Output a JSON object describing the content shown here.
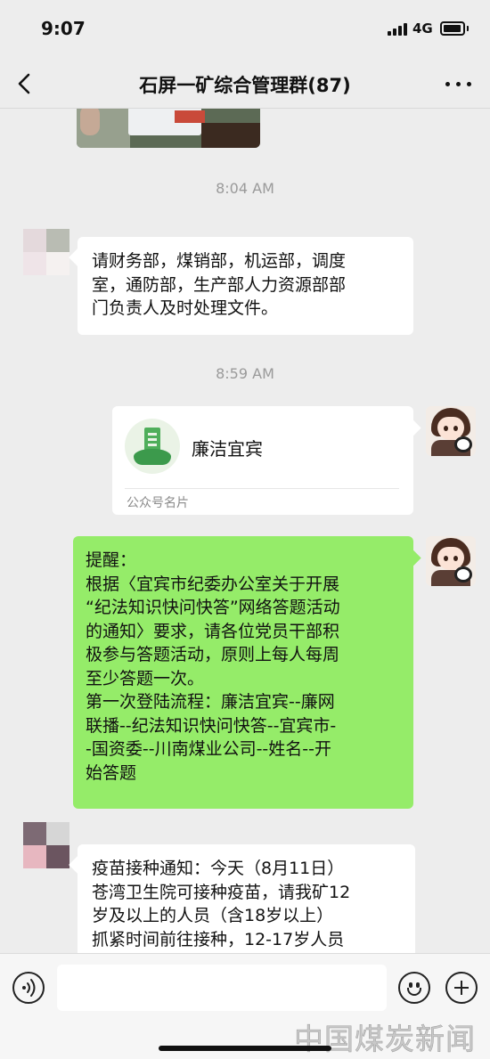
{
  "status_bar": {
    "time": "9:07",
    "network": "4G"
  },
  "nav": {
    "title": "石屏一矿综合管理群(87)"
  },
  "timestamps": [
    "8:04 AM",
    "8:59 AM"
  ],
  "messages": [
    {
      "side": "left",
      "type": "text",
      "lines": [
        "请财务部，煤销部，机运部，调度",
        "室，通防部，生产部人力资源部部",
        "门负责人及时处理文件。"
      ]
    },
    {
      "side": "right",
      "type": "card",
      "card_name": "廉洁宜宾",
      "card_type": "公众号名片"
    },
    {
      "side": "right",
      "type": "text",
      "lines": [
        "提醒：",
        "根据〈宜宾市纪委办公室关于开展",
        "“纪法知识快问快答”网络答题活动",
        "的通知〉要求，请各位党员干部积",
        "极参与答题活动，原则上每人每周",
        "至少答题一次。",
        "第一次登陆流程：廉洁宜宾--廉网",
        "联播--纪法知识快问快答--宜宾市-",
        "-国资委--川南煤业公司--姓名--开",
        "始答题"
      ]
    },
    {
      "side": "left",
      "type": "text",
      "lines": [
        "疫苗接种通知：今天（8月11日）",
        "苍湾卫生院可接种疫苗，请我矿12",
        "岁及以上的人员（含18岁以上）",
        "抓紧时间前往接种，12-17岁人员"
      ]
    }
  ],
  "input": {
    "placeholder": "",
    "value": ""
  },
  "watermark": "中国煤炭新闻网",
  "icons": {
    "back": "chevron-left-icon",
    "more": "more-dots-icon",
    "voice": "voice-icon",
    "emoji": "emoji-icon",
    "plus": "plus-icon"
  }
}
